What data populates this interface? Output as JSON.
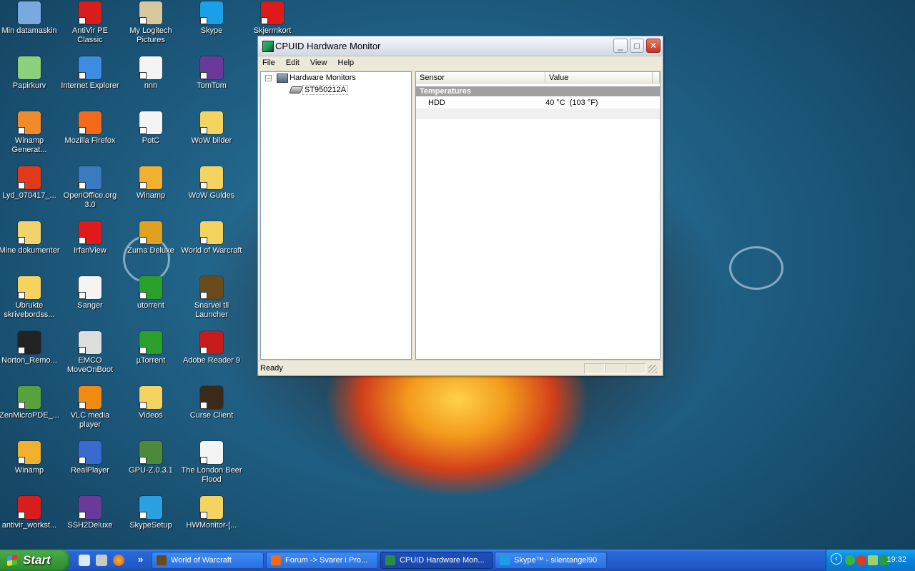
{
  "desktop": {
    "icons": [
      {
        "label": "Min datamaskin",
        "color": "#7aa9e0"
      },
      {
        "label": "Papirkurv",
        "color": "#8bd17c"
      },
      {
        "label": "Winamp Generat...",
        "color": "#f08a2a"
      },
      {
        "label": "Lyd_070417_...",
        "color": "#e03a1a"
      },
      {
        "label": "Mine dokumenter",
        "color": "#f2d36b"
      },
      {
        "label": "Ubrukte skrivebordss...",
        "color": "#f4d35e"
      },
      {
        "label": "Norton_Remo...",
        "color": "#222222"
      },
      {
        "label": "ZenMicroPDE_...",
        "color": "#57a23c"
      },
      {
        "label": "Winamp",
        "color": "#f0b030"
      },
      {
        "label": "antivir_workst...",
        "color": "#d91c1c"
      },
      {
        "label": "AntiVir PE Classic",
        "color": "#d91c1c"
      },
      {
        "label": "Internet Explorer",
        "color": "#3a8de0"
      },
      {
        "label": "Mozilla Firefox",
        "color": "#f06a1a"
      },
      {
        "label": "OpenOffice.org 3.0",
        "color": "#3a7ac0"
      },
      {
        "label": "IrfanView",
        "color": "#e01a1a"
      },
      {
        "label": "Sanger",
        "color": "#f4f4f4"
      },
      {
        "label": "EMCO MoveOnBoot",
        "color": "#dddddd"
      },
      {
        "label": "VLC media player",
        "color": "#f08a10"
      },
      {
        "label": "RealPlayer",
        "color": "#3a6ad0"
      },
      {
        "label": "SSH2Deluxe",
        "color": "#6a3a9a"
      },
      {
        "label": "My Logitech Pictures",
        "color": "#d8c8a0"
      },
      {
        "label": "nnn",
        "color": "#f4f4f4"
      },
      {
        "label": "PotC",
        "color": "#f4f4f4"
      },
      {
        "label": "Winamp",
        "color": "#f0b030"
      },
      {
        "label": "Zuma Deluxe",
        "color": "#e0a020"
      },
      {
        "label": "utorrent",
        "color": "#2aa02a"
      },
      {
        "label": "µTorrent",
        "color": "#2aa02a"
      },
      {
        "label": "Videos",
        "color": "#f4d35e"
      },
      {
        "label": "GPU-Z.0.3.1",
        "color": "#4a8a3a"
      },
      {
        "label": "SkypeSetup",
        "color": "#2aa0e0"
      },
      {
        "label": "Skype",
        "color": "#1aa0e8"
      },
      {
        "label": "TomTom",
        "color": "#6a3a9a"
      },
      {
        "label": "WoW bilder",
        "color": "#f4d35e"
      },
      {
        "label": "WoW Guides",
        "color": "#f4d35e"
      },
      {
        "label": "World of Warcraft",
        "color": "#f4d35e"
      },
      {
        "label": "Snarvei til Launcher",
        "color": "#6a4a1a"
      },
      {
        "label": "Adobe Reader 9",
        "color": "#c81a1a"
      },
      {
        "label": "Curse Client",
        "color": "#3a2a1a"
      },
      {
        "label": "The London Beer Flood",
        "color": "#f4f4f4"
      },
      {
        "label": "HWMonitor-[...",
        "color": "#f4d35e"
      },
      {
        "label": "Skjermkort",
        "color": "#e01a1a"
      }
    ]
  },
  "window": {
    "title": "CPUID Hardware Monitor",
    "minimize": "_",
    "maximize": "□",
    "close": "✕",
    "menu": [
      "File",
      "Edit",
      "View",
      "Help"
    ],
    "tree": {
      "root": "Hardware Monitors",
      "root_toggle": "−",
      "child": "ST950212A"
    },
    "list": {
      "columns": [
        "Sensor",
        "Value"
      ],
      "group": "Temperatures",
      "rows": [
        {
          "sensor": "HDD",
          "value": "40 °C  (103 °F)"
        }
      ]
    },
    "status": "Ready"
  },
  "taskbar": {
    "start": "Start",
    "more": "»",
    "tasks": [
      {
        "label": "World of Warcraft",
        "color": "#6a4a1a"
      },
      {
        "label": "Forum -> Svarer i Pro...",
        "color": "#f06a1a"
      },
      {
        "label": "CPUID Hardware Mon...",
        "color": "#2a8a4a"
      },
      {
        "label": "Skype™ - silentangel90",
        "color": "#1aa0e8"
      }
    ],
    "tray_arrow": "‹",
    "clock": "19:32"
  }
}
